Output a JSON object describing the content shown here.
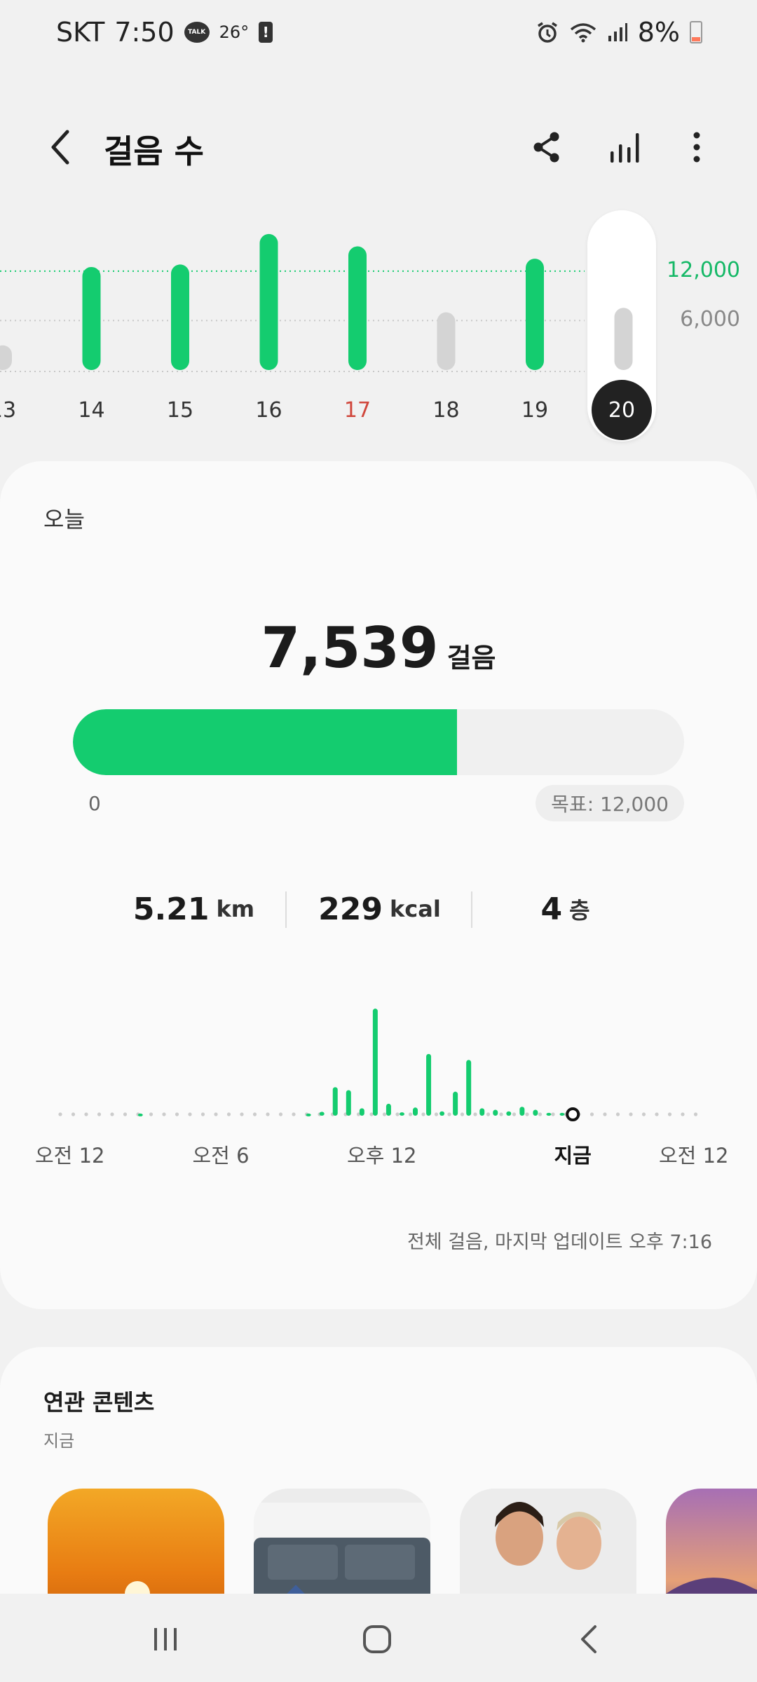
{
  "status_bar": {
    "carrier": "SKT",
    "time": "7:50",
    "talk_badge": "TALK",
    "temperature": "26°",
    "alert_glyph": "!",
    "battery": "8%",
    "battery_color": "#ff7a5c",
    "icons": [
      "talk-icon",
      "alert-icon",
      "alarm-icon",
      "wifi-icon",
      "signal-icon",
      "battery-icon"
    ]
  },
  "header": {
    "title": "걸음 수",
    "icons": [
      "back-icon",
      "share-icon",
      "bar-chart-icon",
      "more-icon"
    ]
  },
  "chart_data": [
    {
      "type": "bar",
      "title": "",
      "categories": [
        "13",
        "14",
        "15",
        "16",
        "17",
        "18",
        "19",
        "20"
      ],
      "values": [
        3000,
        12500,
        12800,
        16500,
        15000,
        7000,
        13500,
        7539
      ],
      "goal_met": [
        false,
        true,
        true,
        true,
        true,
        false,
        true,
        false
      ],
      "highlight_category": "17",
      "highlight_color": "#d0463b",
      "selected_category": "20",
      "ytick_labels": [
        "12,000",
        "6,000"
      ],
      "ytick_values": [
        12000,
        6000
      ],
      "goal_line": 12000,
      "ylim": [
        0,
        17000
      ],
      "colors": {
        "met": "#14cc6f",
        "not_met": "#d4d4d4",
        "goal_label": "#14b866",
        "axis_label": "#888888"
      }
    },
    {
      "type": "bar",
      "title": "",
      "x_hours": [
        3,
        9.3,
        9.8,
        10.3,
        10.8,
        11.3,
        11.8,
        12.3,
        12.8,
        13.3,
        13.8,
        14.3,
        14.8,
        15.3,
        15.8,
        16.3,
        16.8,
        17.3,
        17.8,
        18.3,
        18.8
      ],
      "values": [
        30,
        30,
        100,
        1080,
        960,
        240,
        4200,
        420,
        80,
        270,
        2400,
        120,
        900,
        2160,
        240,
        180,
        120,
        300,
        180,
        60,
        60
      ],
      "xtick_labels": [
        "오전 12",
        "오전 6",
        "오후 12",
        "지금",
        "오전 12"
      ],
      "xtick_hours": [
        0,
        6,
        12,
        19.2,
        24
      ],
      "now_hour": 19.2,
      "xlim": [
        0,
        24
      ],
      "ylim": [
        0,
        4400
      ],
      "colors": {
        "bar": "#14cc6f",
        "dots": "#cccccc"
      }
    }
  ],
  "today": {
    "label": "오늘",
    "steps": "7,539",
    "steps_unit": "걸음",
    "progress_fraction": 0.628,
    "progress_color": "#14cc6f",
    "progress_start": "0",
    "goal": "목표: 12,000",
    "stats": [
      {
        "value": "5.21",
        "unit": "km"
      },
      {
        "value": "229",
        "unit": "kcal"
      },
      {
        "value": "4",
        "unit": "층"
      }
    ],
    "update_note": "전체 걸음, 마지막 업데이트 오후 7:16"
  },
  "related": {
    "title": "연관 콘텐츠",
    "subtitle": "지금"
  },
  "nav": {
    "icons": [
      "recent-apps-icon",
      "home-icon",
      "back-nav-icon"
    ]
  }
}
